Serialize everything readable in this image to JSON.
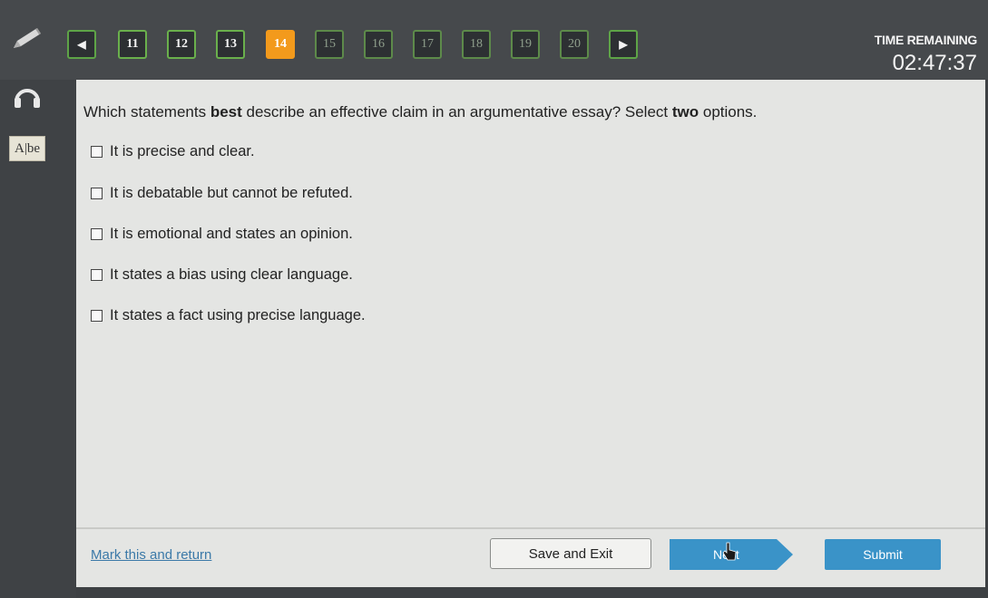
{
  "nav": {
    "prev_symbol": "◀",
    "next_symbol": "▶",
    "questions": [
      {
        "label": "11",
        "status": "answered"
      },
      {
        "label": "12",
        "status": "answered"
      },
      {
        "label": "13",
        "status": "answered"
      },
      {
        "label": "14",
        "status": "current"
      },
      {
        "label": "15",
        "status": "pending"
      },
      {
        "label": "16",
        "status": "pending"
      },
      {
        "label": "17",
        "status": "pending"
      },
      {
        "label": "18",
        "status": "pending"
      },
      {
        "label": "19",
        "status": "pending"
      },
      {
        "label": "20",
        "status": "pending"
      }
    ]
  },
  "timer": {
    "label": "TIME REMAINING",
    "value": "02:47:37"
  },
  "tools": {
    "pencil_icon": "pencil-icon",
    "audio_icon": "headphones-icon",
    "dictionary_icon": "dictionary-icon",
    "dictionary_label": "A|be"
  },
  "question": {
    "pre": "Which statements ",
    "emph": "best",
    "mid": " describe an effective claim in an argumentative essay? Select ",
    "emph2": "two",
    "post": " options."
  },
  "options": [
    "It is precise and clear.",
    "It is debatable but cannot be refuted.",
    "It is emotional and states an opinion.",
    "It states a bias using clear language.",
    "It states a fact using precise language."
  ],
  "footer": {
    "mark_label": "Mark this and return",
    "save_label": "Save and Exit",
    "next_label": "Next",
    "submit_label": "Submit"
  },
  "colors": {
    "current_question": "#f39a1c",
    "answered_border": "#6ab04c",
    "next_button": "#3a93c8",
    "submit_button": "#3a93c8",
    "link": "#3b79a8"
  }
}
